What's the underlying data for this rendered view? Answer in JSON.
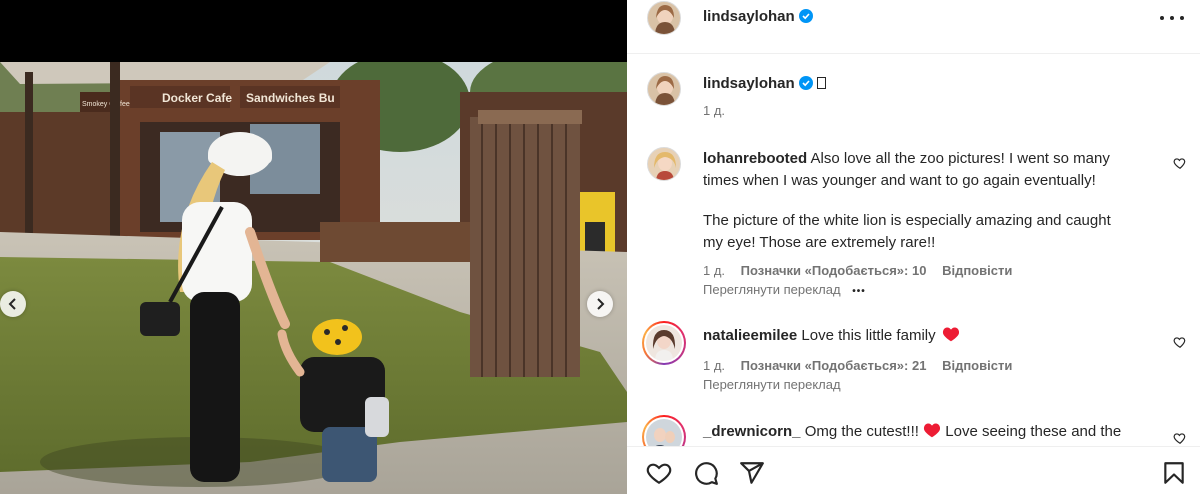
{
  "post": {
    "author": "lindsaylohan",
    "caption_time": "1 д."
  },
  "comments": [
    {
      "username": "lohanrebooted",
      "text_line1": "Also love all the zoo pictures! I went so many",
      "text_line2": "times when I was younger and want to go again eventually!",
      "text_line3": "The picture of the white lion is especially amazing and caught",
      "text_line4": "my eye! Those are extremely rare!!",
      "time": "1 д.",
      "likes": "Позначки «Подобається»: 10",
      "reply": "Відповісти",
      "translate": "Переглянути переклад",
      "more": "•••"
    },
    {
      "username": "natalieemilee",
      "text": "Love this little family",
      "time": "1 д.",
      "likes": "Позначки «Подобається»: 21",
      "reply": "Відповісти",
      "translate": "Переглянути переклад"
    },
    {
      "username": "_drewnicorn_",
      "text_before": "Omg the cutest!!!",
      "text_after": "Love seeing these and the"
    }
  ],
  "photo_signs": {
    "sign1": "Docker Cafe",
    "sign2": "Sandwiches Bu",
    "sign3": "Smokey Coffee"
  },
  "colors": {
    "verified": "#0095f6",
    "heart_red": "#ed1c34",
    "text_primary": "#262626",
    "text_secondary": "#737373"
  },
  "icons": {
    "like": "heart-outline-icon",
    "comment": "speech-bubble-icon",
    "share": "paper-plane-icon",
    "save": "bookmark-icon",
    "more": "more-options-icon",
    "prev": "chevron-left-icon",
    "next": "chevron-right-icon"
  }
}
